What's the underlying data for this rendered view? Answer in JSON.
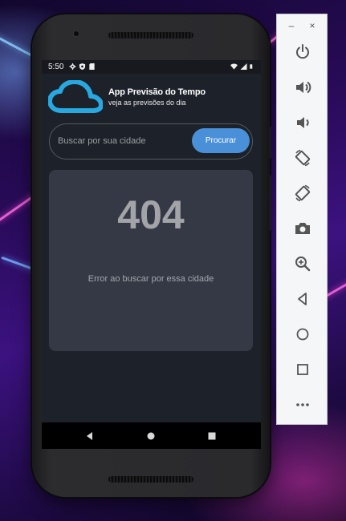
{
  "status_bar": {
    "time": "5:50"
  },
  "app": {
    "title": "App Previsão do Tempo",
    "subtitle": "veja as previsões do dia"
  },
  "search": {
    "placeholder": "Buscar por sua cidade",
    "value": "",
    "button_label": "Procurar"
  },
  "result": {
    "code": "404",
    "message": "Error ao buscar por essa cidade"
  },
  "colors": {
    "accent": "#4a90d9",
    "logo": "#29a8e0",
    "screen_bg": "#1d2129",
    "card_bg": "#353945"
  },
  "emulator_toolbar": {
    "window_controls": [
      "minimize-icon",
      "close-icon"
    ],
    "buttons": [
      "power-icon",
      "volume-up-icon",
      "volume-down-icon",
      "rotate-left-icon",
      "rotate-right-icon",
      "camera-icon",
      "zoom-icon",
      "back-icon",
      "home-icon",
      "overview-icon",
      "more-icon"
    ]
  }
}
